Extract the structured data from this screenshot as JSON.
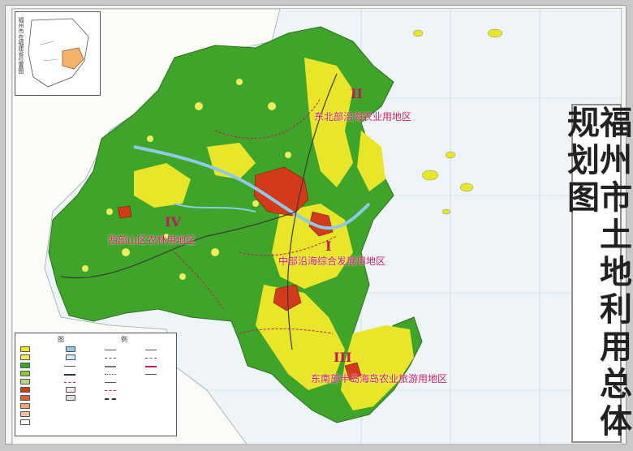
{
  "map": {
    "title": "福州市土地利用总体规划图",
    "inset_title": "福州市在福建省位置图",
    "legend_title_left": "图",
    "legend_title_right": "例",
    "zones": [
      {
        "roman": "II",
        "label": "东北部沿海农业用地区"
      },
      {
        "roman": "IV",
        "label": "西部山区农林用地区"
      },
      {
        "roman": "I",
        "label": "中部沿海综合发展用地区"
      },
      {
        "roman": "III",
        "label": "东南部半岛海岛农业旅游用地区"
      }
    ],
    "colors": {
      "forest": "#3fa52a",
      "farmland": "#e9e62a",
      "urban": "#d23a1a",
      "sea": "#eef4f7",
      "water": "#8ec9e8",
      "zone_label": "#d81b60"
    }
  }
}
